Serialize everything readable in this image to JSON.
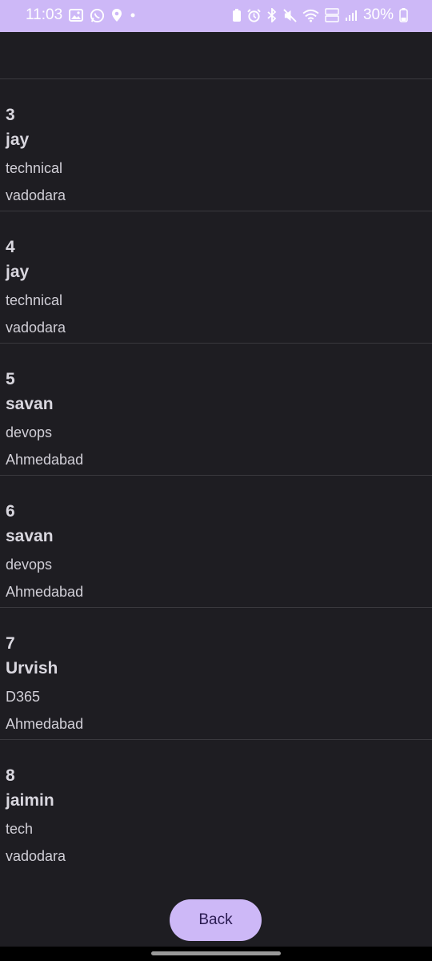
{
  "status_bar": {
    "time": "11:03",
    "battery": "30%",
    "left_icons": [
      "gallery-icon",
      "whatsapp-icon",
      "location-icon",
      "dot-icon"
    ],
    "right_icons": [
      "battery-saver-icon",
      "alarm-icon",
      "bluetooth-icon",
      "mute-icon",
      "wifi-icon",
      "volte-icon",
      "signal-icon",
      "battery-icon"
    ],
    "volte_label": "VoLTE"
  },
  "employees": [
    {
      "id": "3",
      "name": "jay",
      "department": "technical",
      "city": "vadodara"
    },
    {
      "id": "4",
      "name": "jay",
      "department": "technical",
      "city": "vadodara"
    },
    {
      "id": "5",
      "name": "savan",
      "department": "devops",
      "city": "Ahmedabad"
    },
    {
      "id": "6",
      "name": "savan",
      "department": "devops",
      "city": "Ahmedabad"
    },
    {
      "id": "7",
      "name": "Urvish",
      "department": "D365",
      "city": "Ahmedabad"
    },
    {
      "id": "8",
      "name": "jaimin",
      "department": "tech",
      "city": "vadodara"
    }
  ],
  "back_button": {
    "label": "Back"
  },
  "colors": {
    "status_bar": "#cdb8f7",
    "background": "#1e1d22",
    "divider": "#3a393e",
    "button": "#cdb8f7",
    "button_text": "#2a1b52"
  }
}
